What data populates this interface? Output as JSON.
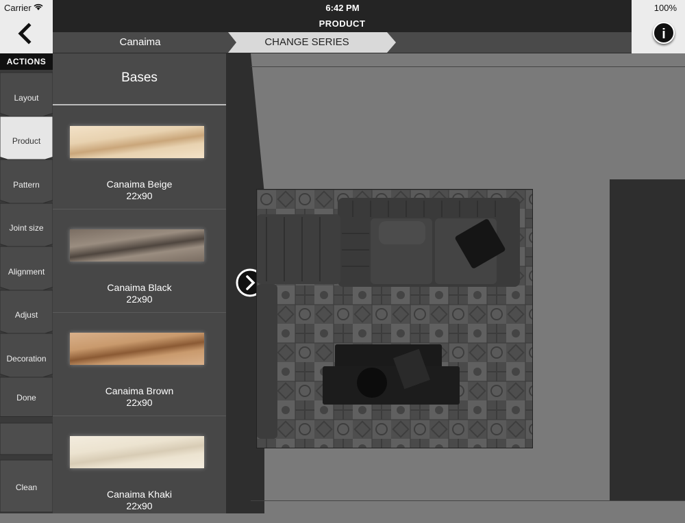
{
  "status": {
    "carrier": "Carrier",
    "time": "6:42 PM",
    "battery": "100%"
  },
  "header": {
    "title": "PRODUCT",
    "crumb_series": "Canaima",
    "crumb_action": "CHANGE SERIES"
  },
  "actions": {
    "title": "ACTIONS",
    "items": [
      "Layout",
      "Product",
      "Pattern",
      "Joint size",
      "Alignment",
      "Adjust",
      "Decoration",
      "Done",
      "",
      "Clean"
    ],
    "active": "Product"
  },
  "bases": {
    "title": "Bases",
    "items": [
      {
        "name": "Canaima Beige",
        "size": "22x90",
        "colors": [
          "#f3e2c8",
          "#caa67a",
          "#e8d2b0"
        ]
      },
      {
        "name": "Canaima Black",
        "size": "22x90",
        "colors": [
          "#7a6d62",
          "#4f463f",
          "#9a8d80"
        ]
      },
      {
        "name": "Canaima Brown",
        "size": "22x90",
        "colors": [
          "#d9b08a",
          "#8b5a34",
          "#c99a6d"
        ]
      },
      {
        "name": "Canaima Khaki",
        "size": "22x90",
        "colors": [
          "#f3ecde",
          "#d8ccb5",
          "#ece3d0"
        ]
      }
    ]
  },
  "icons": {
    "back": "chevron-left-icon",
    "info": "info-icon",
    "toggle": "chevron-right-circle-icon"
  }
}
